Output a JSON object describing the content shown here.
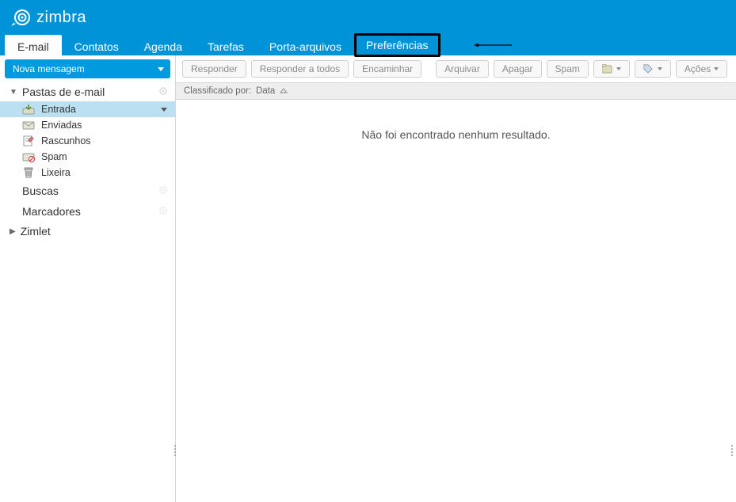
{
  "brand": "zimbra",
  "tabs": [
    {
      "label": "E-mail",
      "active": true,
      "highlight": false
    },
    {
      "label": "Contatos",
      "active": false,
      "highlight": false
    },
    {
      "label": "Agenda",
      "active": false,
      "highlight": false
    },
    {
      "label": "Tarefas",
      "active": false,
      "highlight": false
    },
    {
      "label": "Porta-arquivos",
      "active": false,
      "highlight": false
    },
    {
      "label": "Preferências",
      "active": false,
      "highlight": true
    }
  ],
  "sidebar": {
    "new_message": "Nova mensagem",
    "folders_header": "Pastas de e-mail",
    "folders": [
      {
        "label": "Entrada",
        "selected": true
      },
      {
        "label": "Enviadas",
        "selected": false
      },
      {
        "label": "Rascunhos",
        "selected": false
      },
      {
        "label": "Spam",
        "selected": false
      },
      {
        "label": "Lixeira",
        "selected": false
      }
    ],
    "searches_label": "Buscas",
    "tags_label": "Marcadores",
    "zimlet_label": "Zimlet"
  },
  "toolbar": {
    "reply": "Responder",
    "reply_all": "Responder a todos",
    "forward": "Encaminhar",
    "archive": "Arquivar",
    "delete": "Apagar",
    "spam": "Spam",
    "actions": "Ações"
  },
  "sort": {
    "label_prefix": "Classificado por:",
    "value": "Data"
  },
  "empty_message": "Não foi encontrado nenhum resultado.",
  "colors": {
    "brand_blue": "#0093d8",
    "light_blue_select": "#bbe0f1",
    "border_grey": "#d6d6d6"
  }
}
